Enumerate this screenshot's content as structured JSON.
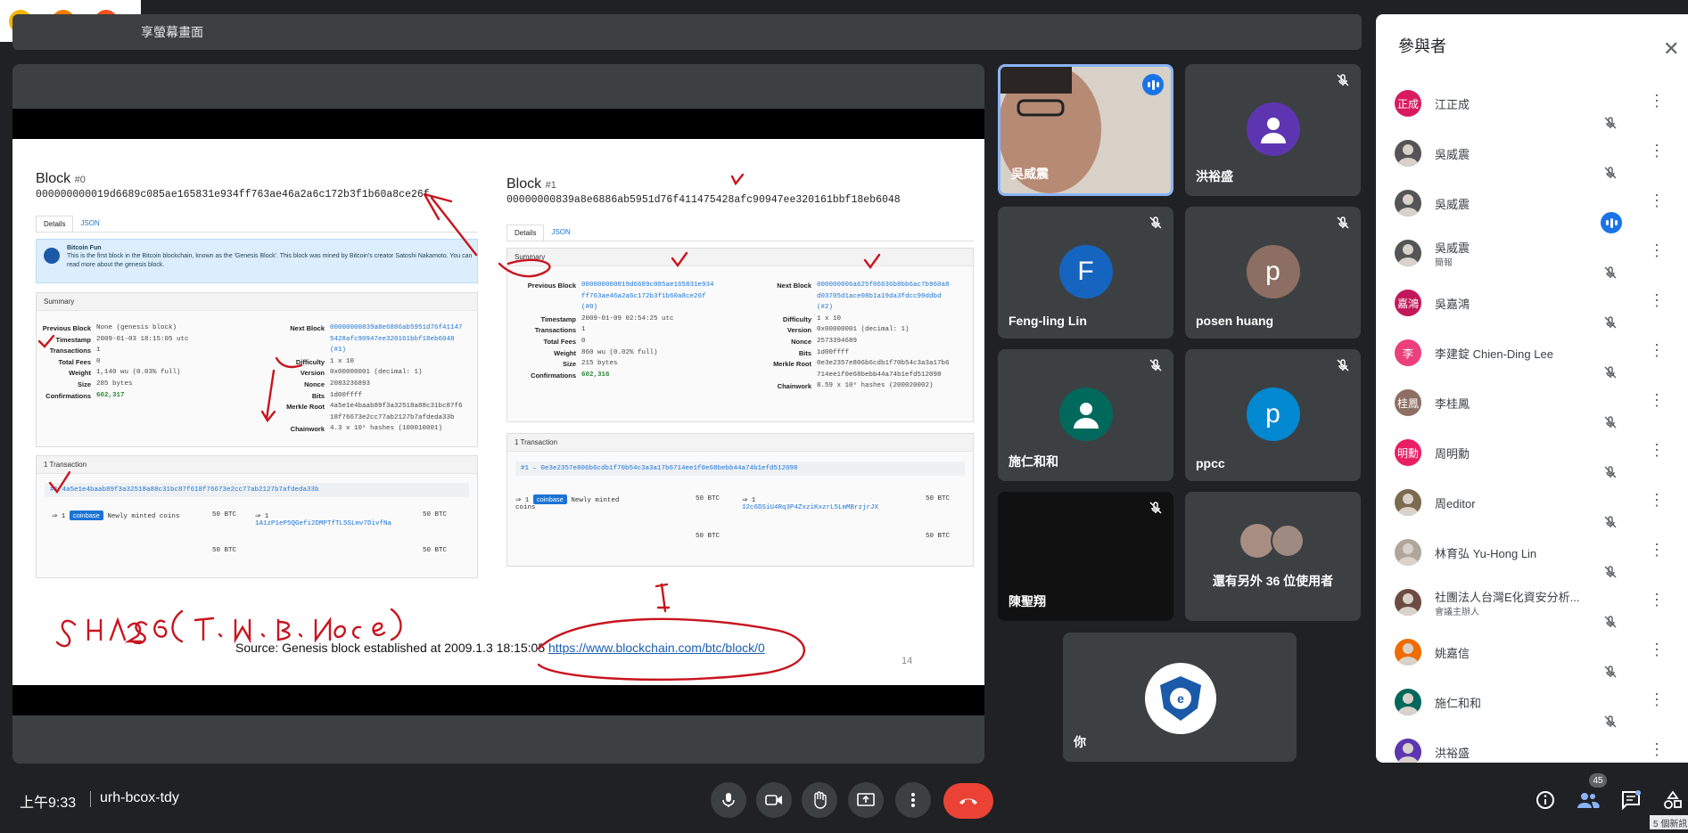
{
  "share_banner": {
    "text": "享螢幕畫面"
  },
  "slide": {
    "block0": {
      "title": "Block",
      "num": "#0",
      "hash": "000000000019d6689c085ae165831e934ff763ae46a2a6c172b3f1b60a8ce26f",
      "tabs": [
        "Details",
        "JSON"
      ],
      "fun_title": "Bitcoin Fun",
      "fun_text": "This is the first block in the Bitcoin blockchain, known as the 'Genesis Block'. This block was mined by Bitcoin's creator Satoshi Nakamoto. You can read more about the genesis block.",
      "summary": "Summary",
      "left_rows": [
        {
          "k": "Previous Block",
          "v": "None (genesis block)"
        },
        {
          "k": "Timestamp",
          "v": "2009-01-03 18:15:05 utc"
        },
        {
          "k": "Transactions",
          "v": "1"
        },
        {
          "k": "Total Fees",
          "v": "0"
        },
        {
          "k": "Weight",
          "v": "1,140 wu (0.03% full)"
        },
        {
          "k": "Size",
          "v": "285 bytes"
        },
        {
          "k": "Confirmations",
          "v": "602,317"
        }
      ],
      "right_rows": [
        {
          "k": "Next Block",
          "v": "00000000839a8e6886ab5951d76f41147"
        },
        {
          "k": "",
          "v": "5428afc90947ee320161bbf18eb6048"
        },
        {
          "k": "",
          "v": "(#1)"
        },
        {
          "k": "Difficulty",
          "v": "1 x 10"
        },
        {
          "k": "Version",
          "v": "0x00000001 (decimal: 1)"
        },
        {
          "k": "Nonce",
          "v": "2083236893"
        },
        {
          "k": "Bits",
          "v": "1d00ffff"
        },
        {
          "k": "Merkle Root",
          "v": "4a5e1e4baab89f3a32518a88c31bc87f6"
        },
        {
          "k": "",
          "v": "18f76673e2cc77ab2127b7afdeda33b"
        },
        {
          "k": "Chainwork",
          "v": "4.3 x 10⁹ hashes (100010001)"
        }
      ],
      "tx_header": "1 Transaction",
      "tx_hash": "#1 4a5e1e4baab89f3a32518a88c31bc87f618f76673e2cc77ab2127b7afdeda33b",
      "tx_in_num": "1",
      "tx_in_label": "coinbase",
      "tx_in_text": "Newly minted coins",
      "tx_in_amt": "50 BTC",
      "tx_out_num": "1",
      "tx_out_addr": "1A1zP1eP5QGefi2DMPTfTL5SLmv7DivfNa",
      "tx_out_amt": "50 BTC",
      "tx_total_in": "50 BTC",
      "tx_total_out": "50 BTC"
    },
    "block1": {
      "title": "Block",
      "num": "#1",
      "hash": "00000000839a8e6886ab5951d76f411475428afc90947ee320161bbf18eb6048",
      "tabs": [
        "Details",
        "JSON"
      ],
      "summary": "Summary",
      "left_rows": [
        {
          "k": "Previous Block",
          "v": "000000000019d6689c085ae165831e934"
        },
        {
          "k": "",
          "v": "ff763ae46a2a6c172b3f1b60a8ce26f"
        },
        {
          "k": "",
          "v": "(#0)"
        },
        {
          "k": "Timestamp",
          "v": "2009-01-09 02:54:25 utc"
        },
        {
          "k": "Transactions",
          "v": "1"
        },
        {
          "k": "Total Fees",
          "v": "0"
        },
        {
          "k": "Weight",
          "v": "860 wu (0.02% full)"
        },
        {
          "k": "Size",
          "v": "215 bytes"
        },
        {
          "k": "Confirmations",
          "v": "602,316"
        }
      ],
      "right_rows": [
        {
          "k": "Next Block",
          "v": "000000006a625f06636b8bb6ac7b960a8"
        },
        {
          "k": "",
          "v": "d03705d1ace08b1a19da3fdcc99ddbd"
        },
        {
          "k": "",
          "v": "(#2)"
        },
        {
          "k": "Difficulty",
          "v": "1 x 10"
        },
        {
          "k": "Version",
          "v": "0x00000001 (decimal: 1)"
        },
        {
          "k": "Nonce",
          "v": "2573394689"
        },
        {
          "k": "Bits",
          "v": "1d00ffff"
        },
        {
          "k": "Merkle Root",
          "v": "0e3e2357e806b6cdb1f70b54c3a3a17b6"
        },
        {
          "k": "",
          "v": "714ee1f0e68bebb44a74b1efd512098"
        },
        {
          "k": "Chainwork",
          "v": "8.59 x 10⁹ hashes (200020002)"
        }
      ],
      "tx_header": "1 Transaction",
      "tx_hash": "#1 – 0e3e2357e806b6cdb1f70b54c3a3a17b6714ee1f0e68bebb44a74b1efd512098",
      "tx_in_num": "1",
      "tx_in_label": "coinbase",
      "tx_in_text": "Newly minted coins",
      "tx_in_amt": "50 BTC",
      "tx_out_num": "1",
      "tx_out_addr": "12c6DSiU4Rq3P4ZxziKxzrL5LmMBrzjrJX",
      "tx_out_amt": "50 BTC",
      "tx_total_in": "50 BTC",
      "tx_total_out": "50 BTC"
    },
    "source_text": "Source: Genesis block established at 2009.1.3 18:15:05",
    "source_url": "https://www.blockchain.com/btc/block/0",
    "page_number": "14",
    "handwriting": "SHA256(T.M.B.Nonce)"
  },
  "tiles": [
    {
      "name": "吳威震",
      "speaking": true
    },
    {
      "name": "洪裕盛"
    },
    {
      "name": "Feng-ling Lin",
      "initial": "F",
      "color": "#1565c0"
    },
    {
      "name": "posen huang",
      "initial": "p",
      "color": "#8d6e63"
    },
    {
      "name": "施仁和和",
      "color": "#00695c"
    },
    {
      "name": "ppcc",
      "initial": "p",
      "color": "#0288d1"
    },
    {
      "name": "陳聖翔"
    },
    {
      "name": "還有另外 36 位使用者"
    },
    {
      "name": "你"
    }
  ],
  "participants": {
    "title": "參與者",
    "badge_count": "45",
    "list": [
      {
        "name": "江正成",
        "initial": "正成",
        "color": "#d81b60"
      },
      {
        "name": "吳威震",
        "initial": "",
        "color": "#555"
      },
      {
        "name": "吳威震",
        "initial": "",
        "color": "#555",
        "speaking": true
      },
      {
        "name": "吳威震",
        "sub": "簡報",
        "initial": "",
        "color": "#555"
      },
      {
        "name": "吳嘉鴻",
        "initial": "嘉鴻",
        "color": "#c2185b"
      },
      {
        "name": "李建錠 Chien-Ding Lee",
        "initial": "李",
        "color": "#ec407a"
      },
      {
        "name": "李桂鳳",
        "initial": "桂鳳",
        "color": "#8d6e63"
      },
      {
        "name": "周明勳",
        "initial": "明勳",
        "color": "#e91e63"
      },
      {
        "name": "周editor",
        "initial": "",
        "color": "#7b6a4e"
      },
      {
        "name": "林育弘 Yu-Hong Lin",
        "initial": "",
        "color": "#b0a79a"
      },
      {
        "name": "社團法人台灣E化資安分析...",
        "sub": "會議主辦人",
        "initial": "",
        "color": "#6d4c41"
      },
      {
        "name": "姚嘉信",
        "initial": "",
        "color": "#ef6c00"
      },
      {
        "name": "施仁和和",
        "initial": "",
        "color": "#00695c"
      },
      {
        "name": "洪裕盛",
        "initial": "",
        "color": "#5e35b1"
      }
    ]
  },
  "bottom": {
    "time": "上午9:33",
    "meeting_code": "urh-bcox-tdy",
    "new_messages": "5 個新訊"
  }
}
